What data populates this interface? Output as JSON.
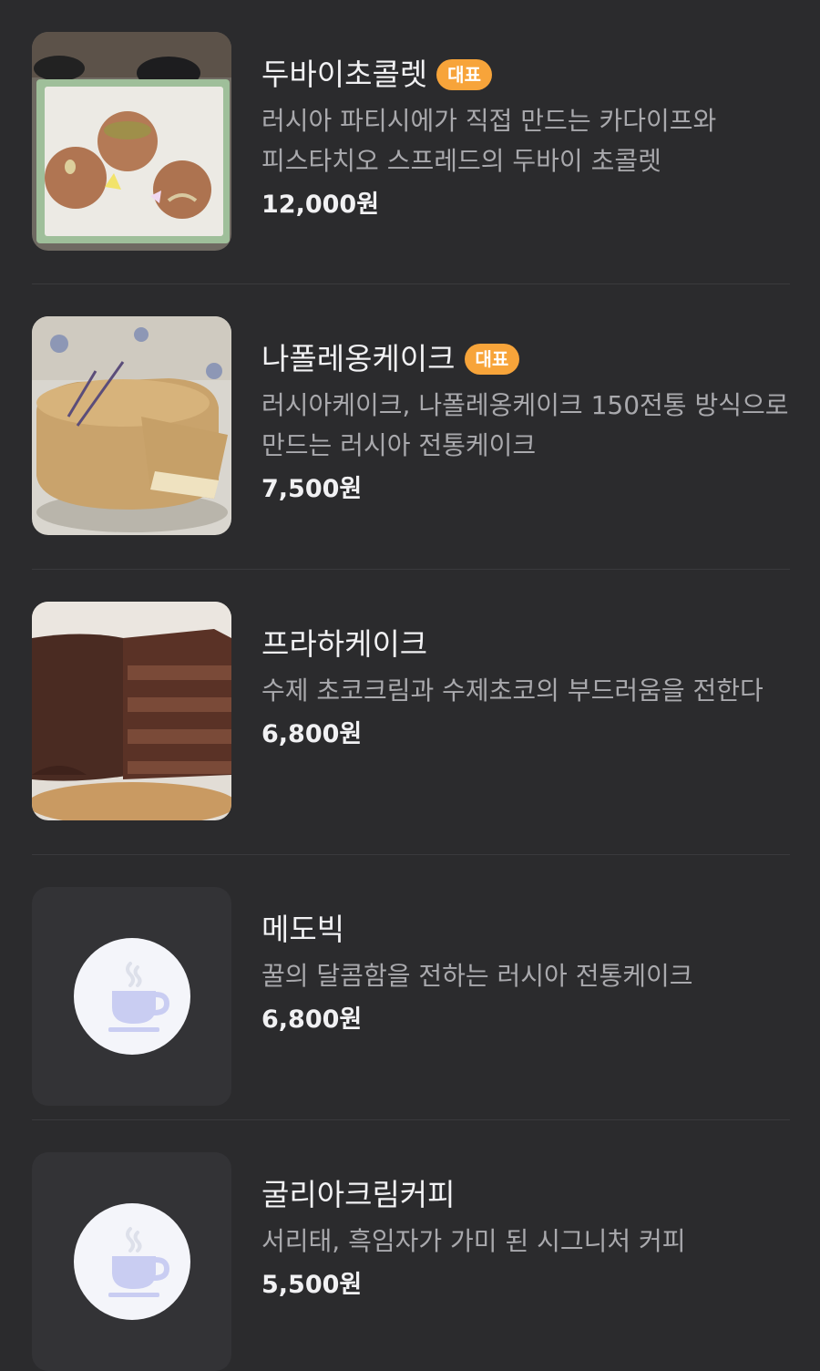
{
  "menu": {
    "items": [
      {
        "name": "두바이초콜렛",
        "badge": "대표",
        "description": "러시아 파티시에가 직접 만드는 카다이프와 피스타치오 스프레드의 두바이 초콜렛",
        "price": "12,000원",
        "image": "dubai-chocolate-photo"
      },
      {
        "name": "나폴레옹케이크",
        "badge": "대표",
        "description": "러시아케이크, 나폴레옹케이크 150전통 방식으로 만드는 러시아 전통케이크",
        "price": "7,500원",
        "image": "napoleon-cake-photo"
      },
      {
        "name": "프라하케이크",
        "description": "수제 초코크림과 수제초코의 부드러움을 전한다",
        "price": "6,800원",
        "image": "praha-cake-photo"
      },
      {
        "name": "메도빅",
        "description": "꿀의 달콤함을 전하는 러시아 전통케이크",
        "price": "6,800원",
        "image": "coffee-cup-icon"
      },
      {
        "name": "굴리아크림커피",
        "description": "서리태, 흑임자가 가미 된 시그니처 커피",
        "price": "5,500원",
        "image": "coffee-cup-icon"
      }
    ]
  },
  "colors": {
    "background": "#2b2b2d",
    "badge": "#f7a43a",
    "text_primary": "#f1f1f3",
    "text_secondary": "#a9a9ad",
    "divider": "#3a3a3d"
  }
}
